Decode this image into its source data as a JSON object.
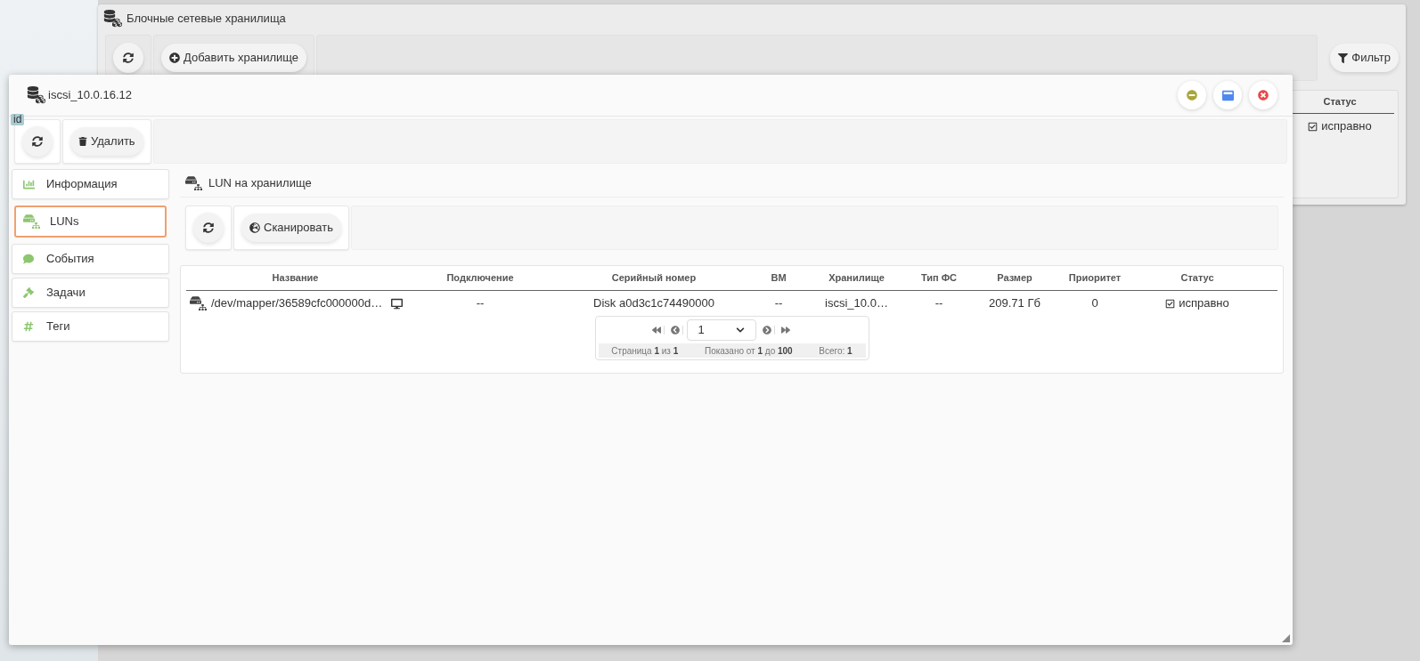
{
  "background_window": {
    "title": "Блочные сетевые хранилища",
    "add_button": "Добавить хранилище",
    "filter_button": "Фильтр",
    "table": {
      "columns": [
        "Статус"
      ],
      "rows": [
        [
          "исправно"
        ]
      ]
    }
  },
  "window": {
    "title": "iscsi_10.0.16.12",
    "badge": "id",
    "delete_button": "Удалить",
    "sidebar": {
      "items": [
        {
          "label": "Информация",
          "kind": "info",
          "selected": false
        },
        {
          "label": "LUNs",
          "kind": "luns",
          "selected": true
        },
        {
          "label": "События",
          "kind": "events",
          "selected": false
        },
        {
          "label": "Задачи",
          "kind": "tasks",
          "selected": false
        },
        {
          "label": "Теги",
          "kind": "tags",
          "selected": false
        }
      ]
    },
    "panel_title": "LUN на хранилище",
    "scan_button": "Сканировать",
    "table": {
      "columns": [
        "Название",
        "Подключение",
        "Серийный номер",
        "ВМ",
        "Хранилище",
        "Тип ФС",
        "Размер",
        "Приоритет",
        "Статус"
      ],
      "rows": [
        [
          "/dev/mapper/36589cfc000000d…",
          "--",
          "Disk a0d3c1c74490000",
          "--",
          "iscsi_10.0…",
          "--",
          "209.71 Гб",
          "0",
          "исправно"
        ]
      ]
    },
    "pagination": {
      "page": "1",
      "info": [
        "Страница **1** из **1**",
        "Показано от **1** до **100**",
        "Всего: **1**"
      ]
    }
  }
}
